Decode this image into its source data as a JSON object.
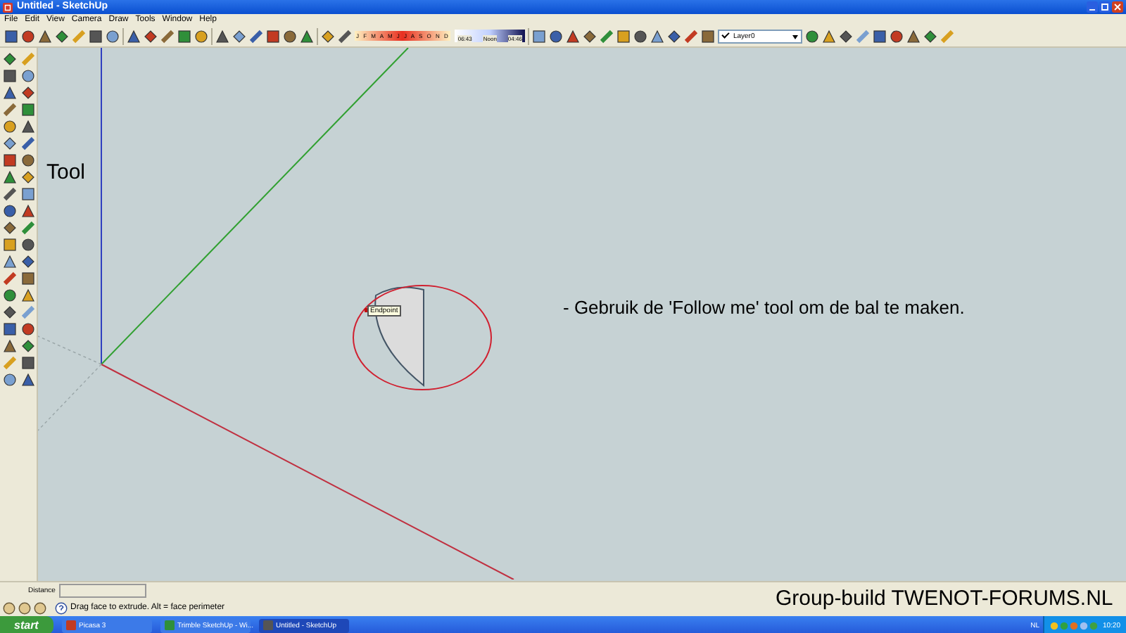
{
  "window": {
    "title": "Untitled - SketchUp"
  },
  "menu": [
    "File",
    "Edit",
    "View",
    "Camera",
    "Draw",
    "Tools",
    "Window",
    "Help"
  ],
  "shadow_settings": {
    "months": "J F M A M J J A S O N D",
    "sunrise": "06:43",
    "noon": "Noon",
    "sunset": "04:46"
  },
  "layer_selector": {
    "value": "Layer0"
  },
  "canvas": {
    "labels": [
      {
        "kind": "side",
        "text": "Tool"
      },
      {
        "kind": "instruction",
        "text": "- Gebruik de 'Follow me' tool om de bal te maken."
      }
    ],
    "tooltip": "Endpoint"
  },
  "measurements": {
    "label": "Distance"
  },
  "status_hint": "Drag face to extrude.  Alt = face perimeter",
  "caption": "Group-build TWENOT-FORUMS.NL",
  "taskbar": {
    "start": "start",
    "tasks": [
      {
        "label": "Picasa 3",
        "selected": false
      },
      {
        "label": "Trimble SketchUp - Wi...",
        "selected": false
      },
      {
        "label": "Untitled - SketchUp",
        "selected": true
      }
    ],
    "language": "NL",
    "clock": "10:20"
  }
}
